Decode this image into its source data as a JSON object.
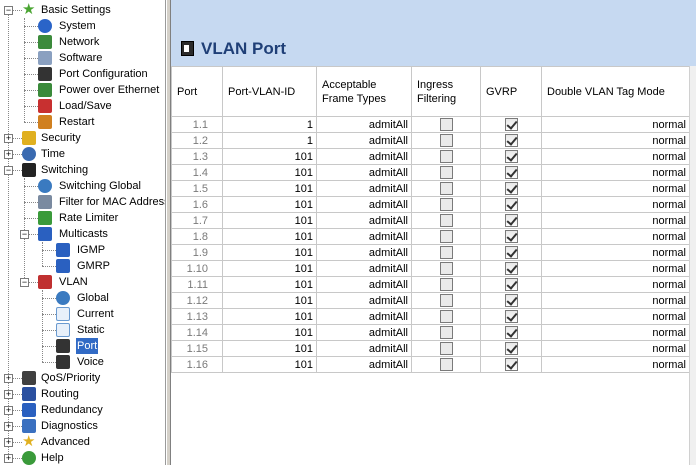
{
  "tree": {
    "nodes": [
      {
        "id": "basic",
        "label": "Basic Settings",
        "depth": 0,
        "expand": "minus",
        "icon": "star-icon",
        "color": "#4aa532"
      },
      {
        "id": "system",
        "label": "System",
        "depth": 1,
        "icon": "info-icon",
        "color": "#2a64c8"
      },
      {
        "id": "network",
        "label": "Network",
        "depth": 1,
        "icon": "network-icon",
        "color": "#3b8a3b"
      },
      {
        "id": "software",
        "label": "Software",
        "depth": 1,
        "icon": "software-icon",
        "color": "#8aa0c0"
      },
      {
        "id": "portcfg",
        "label": "Port Configuration",
        "depth": 1,
        "icon": "port-icon",
        "color": "#333333"
      },
      {
        "id": "poe",
        "label": "Power over Ethernet",
        "depth": 1,
        "icon": "poe-icon",
        "color": "#3a8a3a"
      },
      {
        "id": "loadsave",
        "label": "Load/Save",
        "depth": 1,
        "icon": "save-icon",
        "color": "#c83030"
      },
      {
        "id": "restart",
        "label": "Restart",
        "depth": 1,
        "icon": "restart-icon",
        "color": "#d08020"
      },
      {
        "id": "security",
        "label": "Security",
        "depth": 0,
        "expand": "plus",
        "icon": "lock-icon",
        "color": "#e0b020"
      },
      {
        "id": "time",
        "label": "Time",
        "depth": 0,
        "expand": "plus",
        "icon": "clock-icon",
        "color": "#3a6ab0"
      },
      {
        "id": "switching",
        "label": "Switching",
        "depth": 0,
        "expand": "minus",
        "icon": "switching-icon",
        "color": "#222222"
      },
      {
        "id": "swglobal",
        "label": "Switching Global",
        "depth": 1,
        "icon": "global-icon",
        "color": "#3a7ac0"
      },
      {
        "id": "macfilter",
        "label": "Filter for MAC Addresses",
        "depth": 1,
        "icon": "filter-icon",
        "color": "#7a8aa0"
      },
      {
        "id": "ratelimiter",
        "label": "Rate Limiter",
        "depth": 1,
        "icon": "rate-icon",
        "color": "#3a9a3a"
      },
      {
        "id": "multicasts",
        "label": "Multicasts",
        "depth": 1,
        "expand": "minus",
        "icon": "multicast-icon",
        "color": "#2a60c0"
      },
      {
        "id": "igmp",
        "label": "IGMP",
        "depth": 2,
        "icon": "igmp-icon",
        "color": "#2a60c0"
      },
      {
        "id": "gmrp",
        "label": "GMRP",
        "depth": 2,
        "icon": "gmrp-icon",
        "color": "#2a60c0"
      },
      {
        "id": "vlan",
        "label": "VLAN",
        "depth": 1,
        "expand": "minus",
        "icon": "vlan-icon",
        "color": "#c03030"
      },
      {
        "id": "vglobal",
        "label": "Global",
        "depth": 2,
        "icon": "global-icon",
        "color": "#3a7ac0"
      },
      {
        "id": "vcurrent",
        "label": "Current",
        "depth": 2,
        "icon": "table-icon",
        "color": "#6a9ad0"
      },
      {
        "id": "vstatic",
        "label": "Static",
        "depth": 2,
        "icon": "table-icon",
        "color": "#6a9ad0"
      },
      {
        "id": "vport",
        "label": "Port",
        "depth": 2,
        "icon": "port-icon",
        "color": "#333333",
        "selected": true
      },
      {
        "id": "vvoice",
        "label": "Voice",
        "depth": 2,
        "icon": "port-icon",
        "color": "#333333"
      },
      {
        "id": "qos",
        "label": "QoS/Priority",
        "depth": 0,
        "expand": "plus",
        "icon": "qos-icon",
        "color": "#404040"
      },
      {
        "id": "routing",
        "label": "Routing",
        "depth": 0,
        "expand": "plus",
        "icon": "routing-icon",
        "color": "#2a50a0"
      },
      {
        "id": "redundancy",
        "label": "Redundancy",
        "depth": 0,
        "expand": "plus",
        "icon": "redundancy-icon",
        "color": "#2a60c0"
      },
      {
        "id": "diagnostics",
        "label": "Diagnostics",
        "depth": 0,
        "expand": "plus",
        "icon": "diagnostics-icon",
        "color": "#3a70c0"
      },
      {
        "id": "advanced",
        "label": "Advanced",
        "depth": 0,
        "expand": "plus",
        "icon": "star-icon",
        "color": "#e0b020"
      },
      {
        "id": "help",
        "label": "Help",
        "depth": 0,
        "expand": "plus",
        "icon": "help-icon",
        "color": "#3a9a3a"
      }
    ]
  },
  "page": {
    "title": "VLAN Port"
  },
  "table": {
    "headers": [
      "Port",
      "Port-VLAN-ID",
      "Acceptable Frame Types",
      "Ingress Filtering",
      "GVRP",
      "Double VLAN Tag Mode"
    ],
    "rows": [
      {
        "port": "1.1",
        "pvid": "1",
        "frame": "admitAll",
        "ingress": false,
        "gvrp": true,
        "dbl": "normal"
      },
      {
        "port": "1.2",
        "pvid": "1",
        "frame": "admitAll",
        "ingress": false,
        "gvrp": true,
        "dbl": "normal"
      },
      {
        "port": "1.3",
        "pvid": "101",
        "frame": "admitAll",
        "ingress": false,
        "gvrp": true,
        "dbl": "normal"
      },
      {
        "port": "1.4",
        "pvid": "101",
        "frame": "admitAll",
        "ingress": false,
        "gvrp": true,
        "dbl": "normal"
      },
      {
        "port": "1.5",
        "pvid": "101",
        "frame": "admitAll",
        "ingress": false,
        "gvrp": true,
        "dbl": "normal"
      },
      {
        "port": "1.6",
        "pvid": "101",
        "frame": "admitAll",
        "ingress": false,
        "gvrp": true,
        "dbl": "normal"
      },
      {
        "port": "1.7",
        "pvid": "101",
        "frame": "admitAll",
        "ingress": false,
        "gvrp": true,
        "dbl": "normal"
      },
      {
        "port": "1.8",
        "pvid": "101",
        "frame": "admitAll",
        "ingress": false,
        "gvrp": true,
        "dbl": "normal"
      },
      {
        "port": "1.9",
        "pvid": "101",
        "frame": "admitAll",
        "ingress": false,
        "gvrp": true,
        "dbl": "normal"
      },
      {
        "port": "1.10",
        "pvid": "101",
        "frame": "admitAll",
        "ingress": false,
        "gvrp": true,
        "dbl": "normal"
      },
      {
        "port": "1.11",
        "pvid": "101",
        "frame": "admitAll",
        "ingress": false,
        "gvrp": true,
        "dbl": "normal"
      },
      {
        "port": "1.12",
        "pvid": "101",
        "frame": "admitAll",
        "ingress": false,
        "gvrp": true,
        "dbl": "normal"
      },
      {
        "port": "1.13",
        "pvid": "101",
        "frame": "admitAll",
        "ingress": false,
        "gvrp": true,
        "dbl": "normal"
      },
      {
        "port": "1.14",
        "pvid": "101",
        "frame": "admitAll",
        "ingress": false,
        "gvrp": true,
        "dbl": "normal"
      },
      {
        "port": "1.15",
        "pvid": "101",
        "frame": "admitAll",
        "ingress": false,
        "gvrp": true,
        "dbl": "normal"
      },
      {
        "port": "1.16",
        "pvid": "101",
        "frame": "admitAll",
        "ingress": false,
        "gvrp": true,
        "dbl": "normal"
      }
    ]
  }
}
